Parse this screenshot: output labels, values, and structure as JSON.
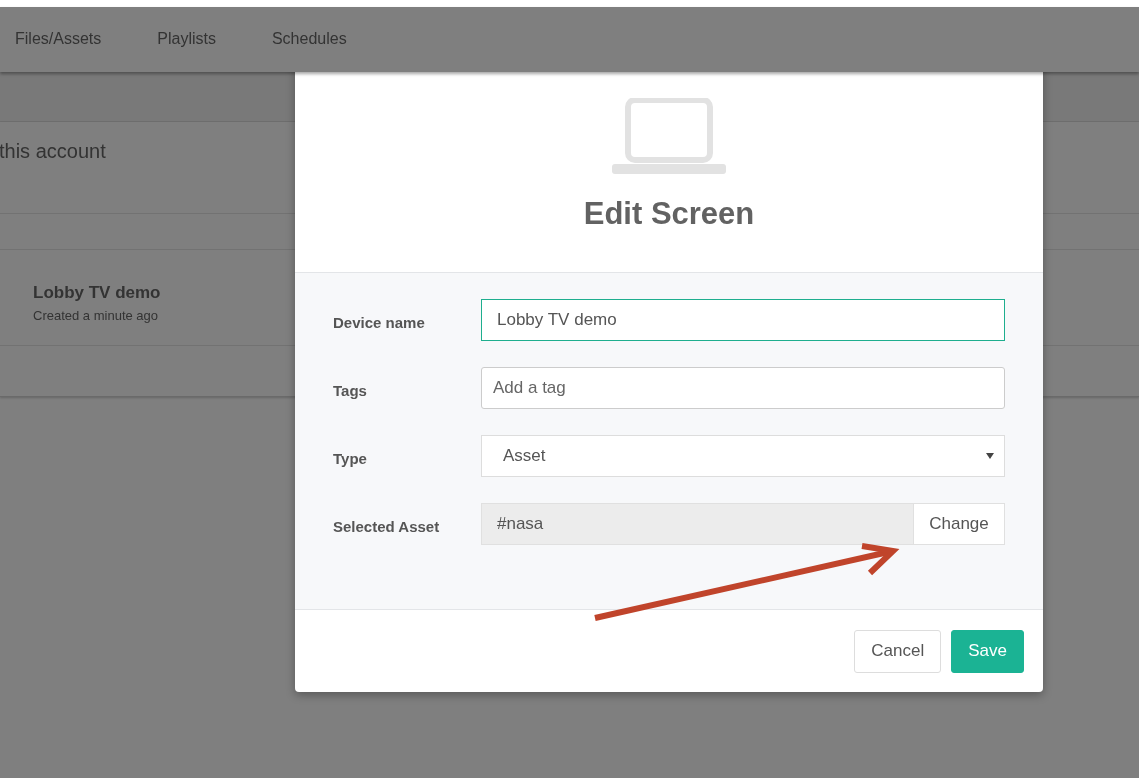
{
  "nav": {
    "tabs": [
      {
        "label": "Files/Assets"
      },
      {
        "label": "Playlists"
      },
      {
        "label": "Schedules"
      }
    ]
  },
  "page": {
    "heading": "this account",
    "screens": [
      {
        "name": "Lobby TV demo",
        "created": "Created a minute ago"
      }
    ]
  },
  "dialog": {
    "title": "Edit Screen",
    "fields": [
      {
        "kind": "text",
        "label": "Device name",
        "value": "Lobby TV demo",
        "focused": true
      },
      {
        "kind": "text",
        "label": "Tags",
        "placeholder": "Add a tag",
        "focused": false
      },
      {
        "kind": "select",
        "label": "Type",
        "value": "Asset"
      },
      {
        "kind": "picker",
        "label": "Selected Asset",
        "value": "#nasa",
        "button": "Change"
      }
    ],
    "buttons": [
      {
        "kind": "secondary",
        "label": "Cancel"
      },
      {
        "kind": "primary",
        "label": "Save"
      }
    ]
  }
}
